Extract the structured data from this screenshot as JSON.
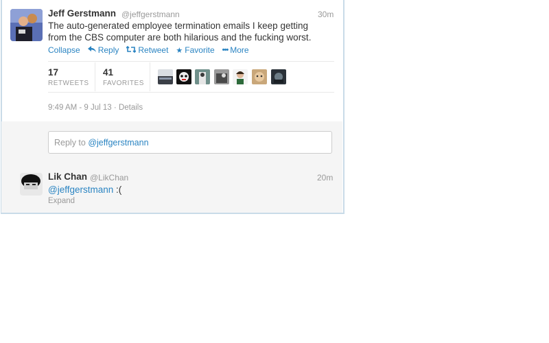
{
  "tweet": {
    "author_name": "Jeff Gerstmann",
    "author_handle": "@jeffgerstmann",
    "time_ago": "30m",
    "text_line1": "The auto-generated employee termination emails I keep getting",
    "text_line2": "from the CBS computer are both hilarious and the fucking worst.",
    "actions": {
      "collapse": "Collapse",
      "reply": "Reply",
      "retweet": "Retweet",
      "favorite": "Favorite",
      "more": "More"
    },
    "stats": {
      "retweets_count": "17",
      "retweets_label": "RETWEETS",
      "favorites_count": "41",
      "favorites_label": "FAVORITES"
    },
    "timestamp": "9:49 AM - 9 Jul 13",
    "details_sep": "·",
    "details_label": "Details"
  },
  "reply_box": {
    "placeholder_prefix": "Reply to ",
    "placeholder_handle": "@jeffgerstmann"
  },
  "reply_tweet": {
    "author_name": "Lik Chan",
    "author_handle": "@LikChan",
    "time_ago": "20m",
    "mention": "@jeffgerstmann",
    "text_rest": " :(",
    "expand": "Expand"
  },
  "colors": {
    "link": "#2a84c2",
    "border": "#c9dbe8",
    "reply_area_bg": "#f5f5f5"
  },
  "icons": {
    "reply": "reply-arrow-icon",
    "retweet": "retweet-icon",
    "favorite": "star-icon",
    "more": "dots-icon"
  }
}
